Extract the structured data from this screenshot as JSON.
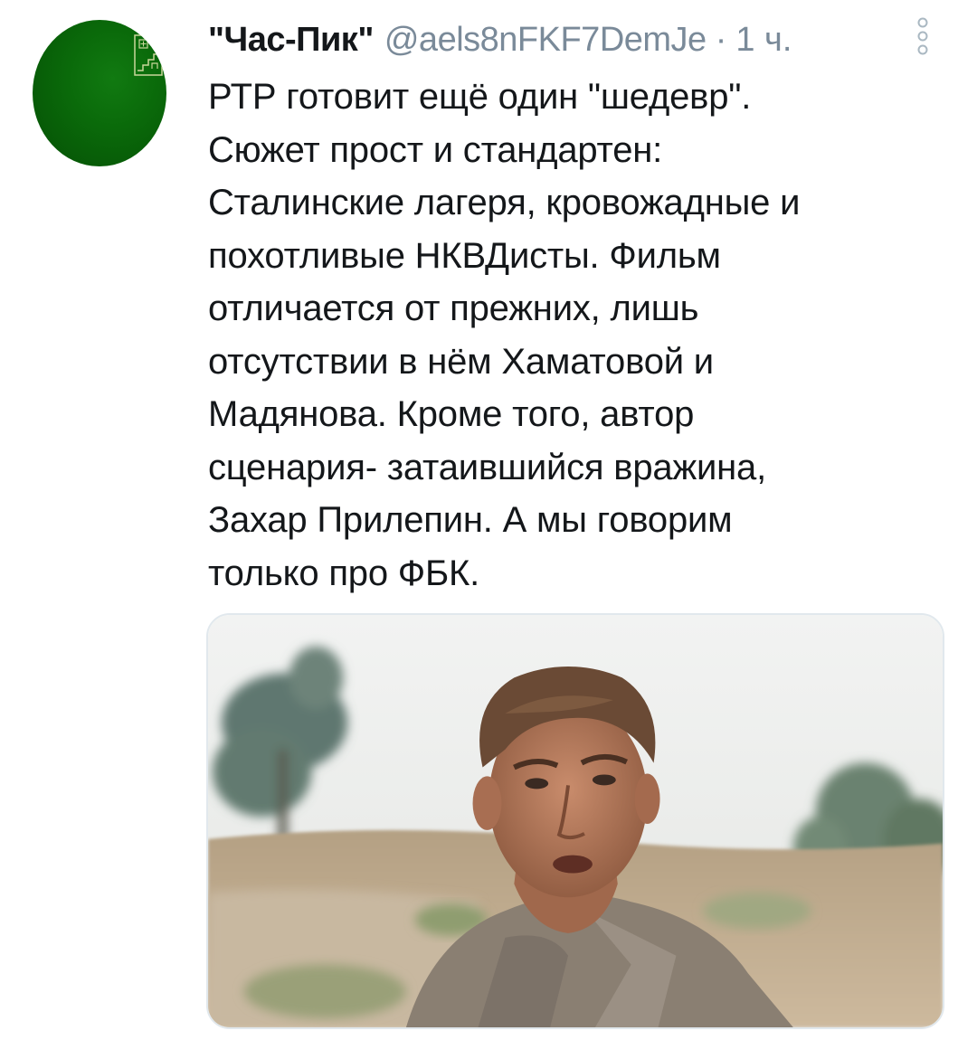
{
  "tweet": {
    "display_name": "\"Час-Пик\"",
    "handle": "@aels8nFKF7DemJe",
    "separator": "·",
    "time": "1 ч.",
    "text": "РТР готовит ещё один \"шедевр\".\nСюжет прост и стандартен:\nСталинские лагеря, кровожадные и\nпохотливые НКВДисты. Фильм\nотличается от прежних, лишь\nотсутствии в нём Хаматовой и\nМадянова. Кроме того, автор\nсценария- затаившийся вражина,\nЗахар Прилепин. А мы говорим\nтолько про ФБК.",
    "avatar": {
      "icon": "avatar-logo-icon",
      "color": "#0a6a0a"
    },
    "more_icon": "more-vertical-icon",
    "media": {
      "description_icon": "photo-man-field-icon"
    }
  },
  "colors": {
    "text": "#14171a",
    "secondary": "#7a8a99",
    "avatar_green": "#0a6a0a",
    "border": "#e1e8ed"
  }
}
